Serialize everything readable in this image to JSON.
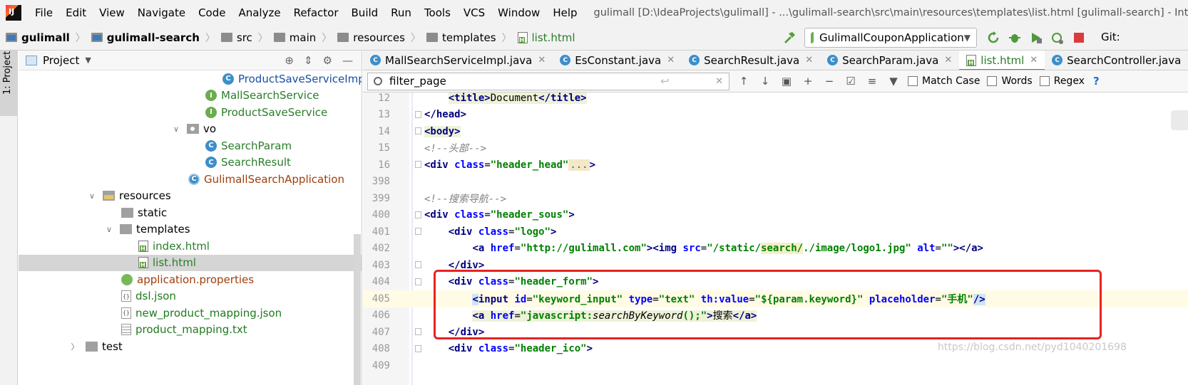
{
  "menubar": {
    "items": [
      "File",
      "Edit",
      "View",
      "Navigate",
      "Code",
      "Analyze",
      "Refactor",
      "Build",
      "Run",
      "Tools",
      "VCS",
      "Window",
      "Help"
    ],
    "window_title": "gulimall [D:\\IdeaProjects\\gulimall] - ...\\gulimall-search\\src\\main\\resources\\templates\\list.html [gulimall-search] - IntelliJ ID"
  },
  "navbar": {
    "crumbs": [
      "gulimall",
      "gulimall-search",
      "src",
      "main",
      "resources",
      "templates",
      "list.html"
    ],
    "run_config": "GulimallCouponApplication",
    "git_label": "Git:"
  },
  "sidestrip": {
    "project_tab": "1: Project"
  },
  "project": {
    "title": "Project",
    "tree": [
      {
        "label": "ProductSaveServiceImp",
        "icon": "class-icon",
        "color": "#1750a3"
      },
      {
        "label": "MallSearchService",
        "icon": "interface-icon",
        "color": "#2a7d2a"
      },
      {
        "label": "ProductSaveService",
        "icon": "interface-icon",
        "color": "#2a7d2a"
      },
      {
        "label": "vo",
        "icon": "package-icon",
        "color": "#000000"
      },
      {
        "label": "SearchParam",
        "icon": "class-icon",
        "color": "#2a7d2a"
      },
      {
        "label": "SearchResult",
        "icon": "class-icon",
        "color": "#2a7d2a"
      },
      {
        "label": "GulimallSearchApplication",
        "icon": "app-class-icon",
        "color": "#a13d0b"
      },
      {
        "label": "resources",
        "icon": "resources-folder-icon",
        "color": "#000000"
      },
      {
        "label": "static",
        "icon": "folder-icon",
        "color": "#000000"
      },
      {
        "label": "templates",
        "icon": "folder-icon",
        "color": "#000000"
      },
      {
        "label": "index.html",
        "icon": "html-file-icon",
        "color": "#2a7d2a"
      },
      {
        "label": "list.html",
        "icon": "html-file-icon",
        "color": "#2a7d2a"
      },
      {
        "label": "application.properties",
        "icon": "properties-file-icon",
        "color": "#a13d0b"
      },
      {
        "label": "dsl.json",
        "icon": "json-file-icon",
        "color": "#1f7a1f"
      },
      {
        "label": "new_product_mapping.json",
        "icon": "json-file-icon",
        "color": "#1f7a1f"
      },
      {
        "label": "product_mapping.txt",
        "icon": "text-file-icon",
        "color": "#1f7a1f"
      },
      {
        "label": "test",
        "icon": "folder-icon",
        "color": "#000000"
      }
    ]
  },
  "editor": {
    "tabs": [
      {
        "label": "MallSearchServiceImpl.java",
        "icon": "class-icon"
      },
      {
        "label": "EsConstant.java",
        "icon": "class-icon"
      },
      {
        "label": "SearchResult.java",
        "icon": "class-icon"
      },
      {
        "label": "SearchParam.java",
        "icon": "class-icon"
      },
      {
        "label": "list.html",
        "icon": "html-file-icon"
      },
      {
        "label": "SearchController.java",
        "icon": "class-icon"
      }
    ],
    "find": {
      "query": "filter_page",
      "match_case": "Match Case",
      "words": "Words",
      "regex": "Regex",
      "help": "?"
    },
    "line_numbers": [
      "12",
      "13",
      "14",
      "15",
      "16",
      "398",
      "399",
      "400",
      "401",
      "402",
      "403",
      "404",
      "405",
      "406",
      "407",
      "408",
      "409"
    ],
    "code": {
      "l12_text": "Document",
      "l15_comment": "<!--头部-->",
      "l16_class": "\"header_head\"",
      "l399_comment": "<!--搜索导航-->",
      "l400_class": "\"header_sous\"",
      "l401_class": "\"logo\"",
      "l402_href": "\"http://gulimall.com\"",
      "l402_src_a": "\"/static/",
      "l402_src_b": "search/",
      "l402_src_c": "./image/logo1.jpg\"",
      "l402_alt": "\"\"",
      "l404_class": "\"header_form\"",
      "l405_id": "\"keyword_input\"",
      "l405_type": "\"text\"",
      "l405_value": "\"${param.keyword}\"",
      "l405_placeholder": "\"手机\"",
      "l406_href_a": "\"javascript:",
      "l406_href_fn": "searchByKeyword",
      "l406_href_b": "();\"",
      "l406_text": "搜索",
      "l408_class": "\"header_ico\""
    },
    "watermark": "https://blog.csdn.net/pyd1040201698"
  }
}
